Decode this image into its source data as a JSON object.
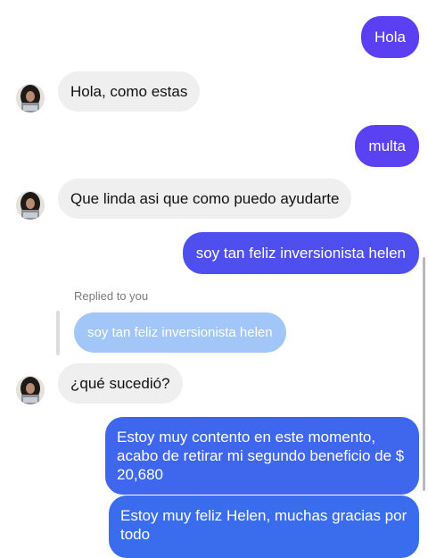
{
  "conversation": {
    "messages": [
      {
        "sender": "me",
        "text": "Hola",
        "color": "#5b3ff2"
      },
      {
        "sender": "contact",
        "text": "Hola, como estas"
      },
      {
        "sender": "me",
        "text": "multa",
        "color": "#5a42f2"
      },
      {
        "sender": "contact",
        "text": "Que linda asi que como puedo ayudarte"
      },
      {
        "sender": "me",
        "text": "soy tan feliz inversionista helen",
        "color": "#4f4ff0"
      },
      {
        "sender": "contact",
        "text": "¿qué sucedió?"
      },
      {
        "sender": "me",
        "text": "Estoy muy contento en este momento, acabo de retirar mi segundo beneficio de $ 20,680",
        "color": "#3f67ee"
      },
      {
        "sender": "me",
        "text": "Estoy muy feliz Helen, muchas gracias por todo",
        "color": "#3a6cee"
      }
    ],
    "reply_context": {
      "label": "Replied to you",
      "quoted_text": "soy tan feliz inversionista helen"
    }
  },
  "icons": {
    "avatar": "contact-avatar-photo"
  }
}
